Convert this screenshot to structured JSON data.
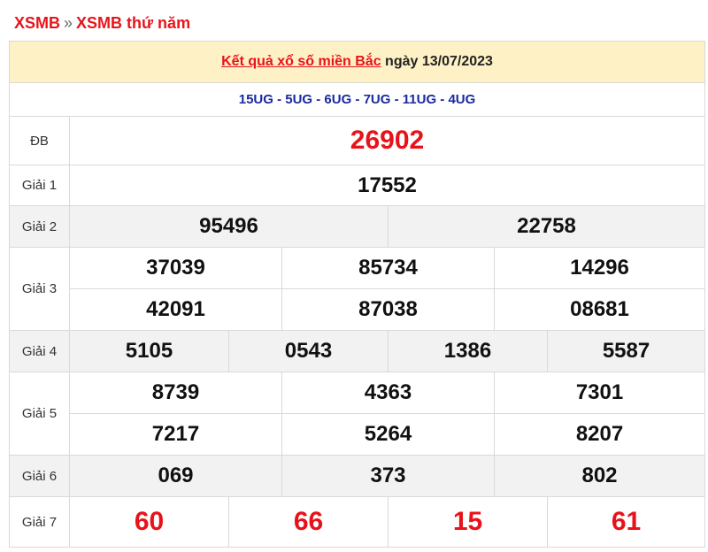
{
  "breadcrumb": {
    "home": "XSMB",
    "separator": "»",
    "current": "XSMB thứ năm"
  },
  "header": {
    "title_link": "Kết quả xổ số miền Bắc",
    "date_text": " ngày 13/07/2023"
  },
  "codes": "15UG - 5UG - 6UG - 7UG - 11UG - 4UG",
  "prizes": {
    "db": {
      "label": "ĐB",
      "numbers": [
        "26902"
      ]
    },
    "g1": {
      "label": "Giải 1",
      "numbers": [
        "17552"
      ]
    },
    "g2": {
      "label": "Giải 2",
      "numbers": [
        "95496",
        "22758"
      ]
    },
    "g3": {
      "label": "Giải 3",
      "numbers": [
        "37039",
        "85734",
        "14296",
        "42091",
        "87038",
        "08681"
      ]
    },
    "g4": {
      "label": "Giải 4",
      "numbers": [
        "5105",
        "0543",
        "1386",
        "5587"
      ]
    },
    "g5": {
      "label": "Giải 5",
      "numbers": [
        "8739",
        "4363",
        "7301",
        "7217",
        "5264",
        "8207"
      ]
    },
    "g6": {
      "label": "Giải 6",
      "numbers": [
        "069",
        "373",
        "802"
      ]
    },
    "g7": {
      "label": "Giải 7",
      "numbers": [
        "60",
        "66",
        "15",
        "61"
      ]
    }
  },
  "colors": {
    "accent_red": "#e8131a",
    "code_blue": "#1a2a9e",
    "header_bg": "#fdf1c5",
    "row_gray": "#f2f2f2"
  }
}
